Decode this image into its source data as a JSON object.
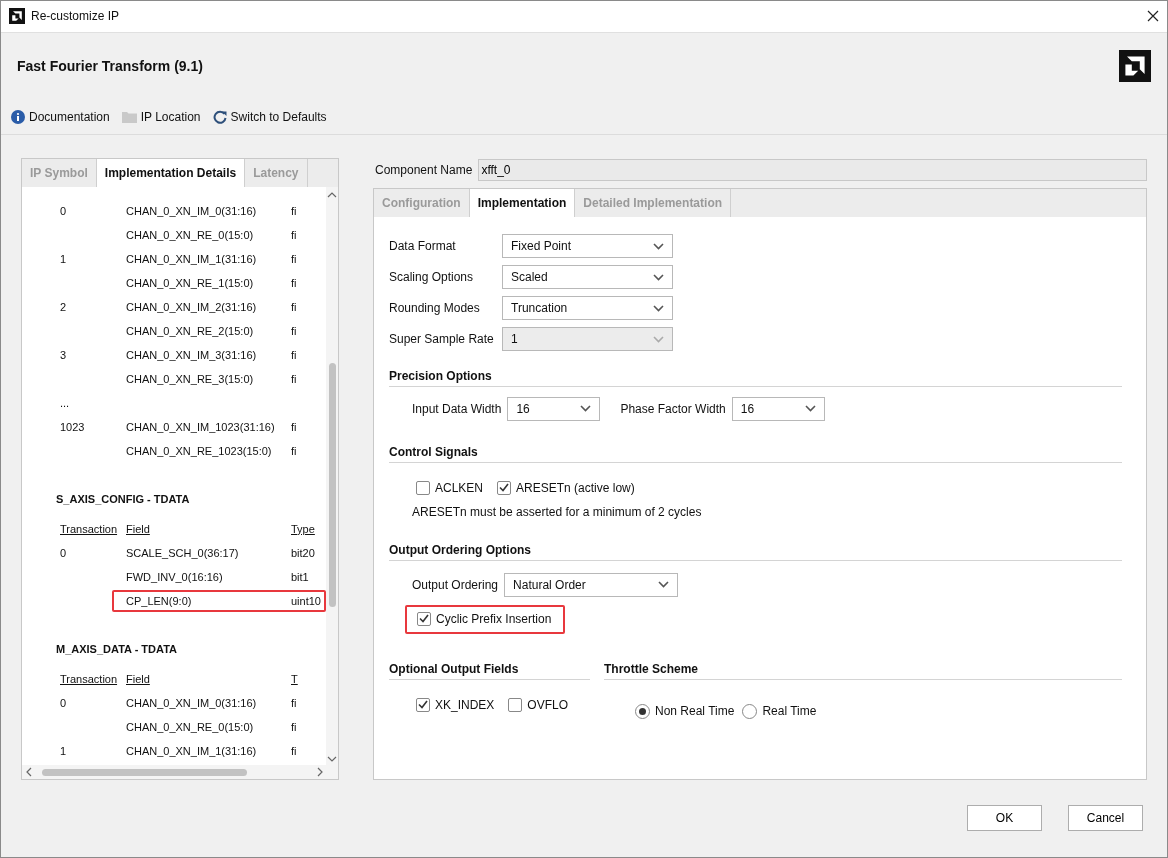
{
  "window": {
    "title": "Re-customize IP"
  },
  "header": {
    "title": "Fast Fourier Transform (9.1)"
  },
  "toolbar": [
    {
      "kind": "info",
      "label": "Documentation"
    },
    {
      "kind": "folder",
      "label": "IP Location"
    },
    {
      "kind": "refresh",
      "label": "Switch to Defaults"
    }
  ],
  "left_panel": {
    "tabs": [
      {
        "label": "IP Symbol",
        "selected": false
      },
      {
        "label": "Implementation Details",
        "selected": true
      },
      {
        "label": "Latency",
        "selected": false
      }
    ],
    "sections": [
      {
        "rows": [
          {
            "transaction": "0",
            "field": "CHAN_0_XN_IM_0(31:16)",
            "type": "fi",
            "highlighted": false
          },
          {
            "field": "CHAN_0_XN_RE_0(15:0)",
            "type": "fi",
            "highlighted": false
          },
          {
            "transaction": "1",
            "field": "CHAN_0_XN_IM_1(31:16)",
            "type": "fi",
            "highlighted": false
          },
          {
            "field": "CHAN_0_XN_RE_1(15:0)",
            "type": "fi",
            "highlighted": false
          },
          {
            "transaction": "2",
            "field": "CHAN_0_XN_IM_2(31:16)",
            "type": "fi",
            "highlighted": false
          },
          {
            "field": "CHAN_0_XN_RE_2(15:0)",
            "type": "fi",
            "highlighted": false
          },
          {
            "transaction": "3",
            "field": "CHAN_0_XN_IM_3(31:16)",
            "type": "fi",
            "highlighted": false
          },
          {
            "field": "CHAN_0_XN_RE_3(15:0)",
            "type": "fi",
            "highlighted": false
          },
          {
            "transaction": "...",
            "highlighted": false
          },
          {
            "transaction": "1023",
            "field": "CHAN_0_XN_IM_1023(31:16)",
            "type": "fi",
            "highlighted": false
          },
          {
            "field": "CHAN_0_XN_RE_1023(15:0)",
            "type": "fi",
            "highlighted": false
          }
        ]
      },
      {
        "title": "S_AXIS_CONFIG - TDATA",
        "header": {
          "transaction": "Transaction",
          "field": "Field",
          "type": "Type"
        },
        "rows": [
          {
            "transaction": "0",
            "field": "SCALE_SCH_0(36:17)",
            "type": "bit20",
            "highlighted": false
          },
          {
            "field": "FWD_INV_0(16:16)",
            "type": "bit1",
            "highlighted": false
          },
          {
            "field": "CP_LEN(9:0)",
            "type": "uint10",
            "highlighted": true
          }
        ]
      },
      {
        "title": "M_AXIS_DATA - TDATA",
        "header": {
          "transaction": "Transaction",
          "field": "Field",
          "type": "T"
        },
        "rows": [
          {
            "transaction": "0",
            "field": "CHAN_0_XN_IM_0(31:16)",
            "type": "fi",
            "highlighted": false
          },
          {
            "field": "CHAN_0_XN_RE_0(15:0)",
            "type": "fi",
            "highlighted": false
          },
          {
            "transaction": "1",
            "field": "CHAN_0_XN_IM_1(31:16)",
            "type": "fi",
            "highlighted": false
          }
        ]
      }
    ]
  },
  "component_name": {
    "label": "Component Name",
    "value": "xfft_0"
  },
  "right_tabs": [
    {
      "label": "Configuration",
      "selected": false
    },
    {
      "label": "Implementation",
      "selected": true
    },
    {
      "label": "Detailed Implementation",
      "selected": false
    }
  ],
  "form": [
    {
      "label": "Data Format",
      "value": "Fixed Point",
      "disabled": false
    },
    {
      "label": "Scaling Options",
      "value": "Scaled",
      "disabled": false
    },
    {
      "label": "Rounding Modes",
      "value": "Truncation",
      "disabled": false
    },
    {
      "label": "Super Sample Rate",
      "value": "1",
      "disabled": true
    }
  ],
  "precision_options": {
    "title": "Precision Options",
    "fields": [
      {
        "label": "Input Data Width",
        "value": "16"
      },
      {
        "label": "Phase Factor Width",
        "value": "16"
      }
    ]
  },
  "control_signals": {
    "title": "Control Signals",
    "checkboxes": [
      {
        "label": "ACLKEN",
        "checked": false
      },
      {
        "label": "ARESETn (active low)",
        "checked": true
      }
    ],
    "note": "ARESETn must be asserted for a minimum of 2 cycles"
  },
  "output_ordering": {
    "title": "Output Ordering Options",
    "field": {
      "label": "Output Ordering",
      "value": "Natural Order"
    },
    "checkbox": {
      "label": "Cyclic Prefix Insertion",
      "checked": true,
      "highlighted": true
    }
  },
  "optional_output_fields": {
    "title": "Optional Output Fields",
    "checkboxes": [
      {
        "label": "XK_INDEX",
        "checked": true
      },
      {
        "label": "OVFLO",
        "checked": false
      }
    ]
  },
  "throttle_scheme": {
    "title": "Throttle Scheme",
    "options": [
      {
        "label": "Non Real Time",
        "selected": true
      },
      {
        "label": "Real Time",
        "selected": false
      }
    ]
  },
  "buttons": [
    "OK",
    "Cancel"
  ]
}
